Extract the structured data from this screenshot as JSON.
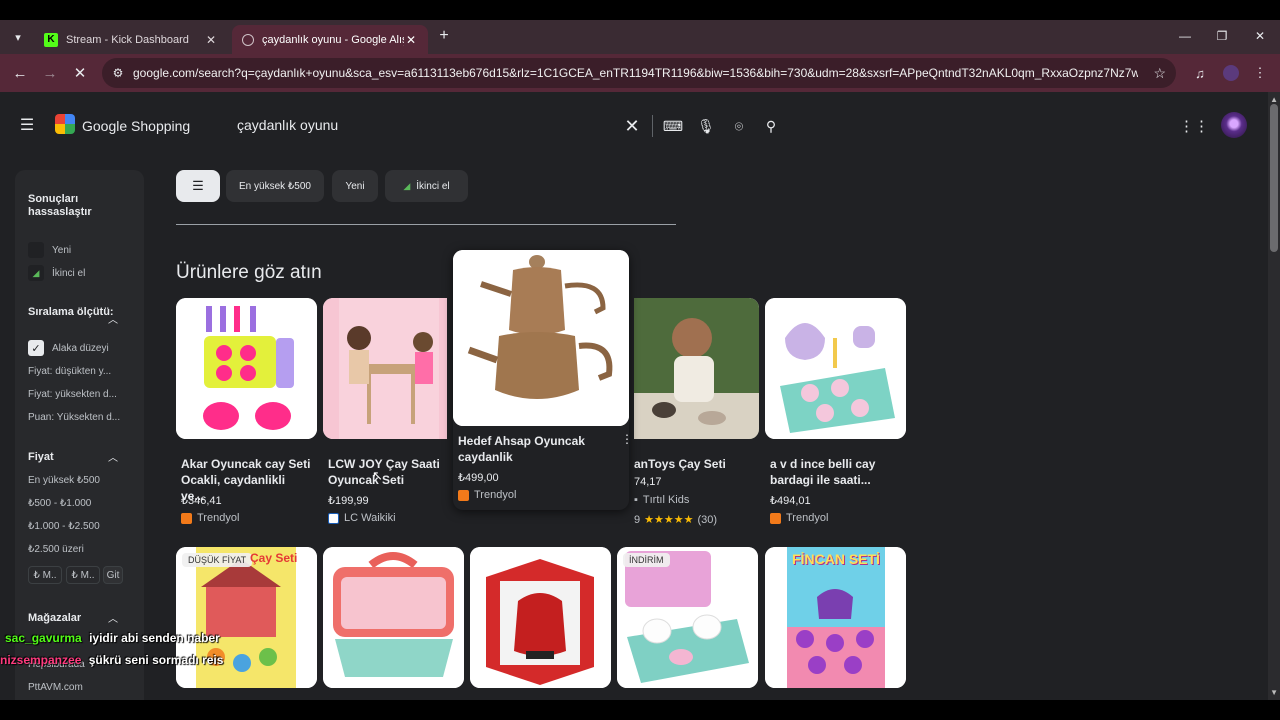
{
  "browser": {
    "tabs": [
      {
        "label": "Stream - Kick Dashboard",
        "favicon": "K"
      },
      {
        "label": "çaydanlık oyunu - Google Alışv"
      }
    ],
    "url": "google.com/search?q=çaydanlık+oyunu&sca_esv=a6113113eb676d15&rlz=1C1GCEA_enTR1194TR1196&biw=1536&bih=730&udm=28&sxsrf=APpeQntndT32nAKL0qm_RxxaOzpnz7Nz7w%3A1..."
  },
  "header": {
    "brand": "Google Shopping",
    "query": "çaydanlık oyunu"
  },
  "chips": [
    "En yüksek ₺500",
    "Yeni",
    "İkinci el"
  ],
  "sidebar": {
    "refine_title": "Sonuçları hassaslaştır",
    "condition": [
      "Yeni",
      "İkinci el"
    ],
    "sort_title": "Sıralama ölçütü:",
    "sort_items": [
      "Alaka düzeyi",
      "Fiyat: düşükten y...",
      "Fiyat: yüksekten d...",
      "Puan: Yüksekten d..."
    ],
    "price_title": "Fiyat",
    "price_items": [
      "En yüksek ₺500",
      "₺500 - ₺1.000",
      "₺1.000 - ₺2.500",
      "₺2.500 üzeri"
    ],
    "price_min": "₺ M..",
    "price_max": "₺ M..",
    "price_go": "Git",
    "stores_title": "Mağazalar",
    "store_items": [
      "Hepsiburada",
      "PttAVM.com"
    ]
  },
  "section_title": "Ürünlere göz atın",
  "products": [
    {
      "title": "Akar Oyuncak cay Seti Ocakli, caydanlikli ve...",
      "price": "₺346,41",
      "store": "Trendyol"
    },
    {
      "title": "LCW JOY Çay Saati Oyuncak Seti",
      "price": "₺199,99",
      "store": "LC Waikiki"
    },
    {
      "title": "Hedef Ahsap Oyuncak caydanlik",
      "price": "₺499,00",
      "store": "Trendyol"
    },
    {
      "title": "anToys Çay Seti",
      "price": "74,17",
      "store": "Tırtıl Kids",
      "rating_count": "(30)"
    },
    {
      "title": "a v d ince belli cay bardagi ile saati...",
      "price": "₺494,01",
      "store": "Trendyol"
    }
  ],
  "row2_badges": [
    "DÜŞÜK FİYAT",
    "İNDİRİM"
  ],
  "row2_texts": [
    "Çay Seti",
    "FİNCAN SETİ"
  ],
  "chat": [
    {
      "user": "sac_gavurma",
      "message": "iyidir abi senden naber",
      "color": "#53fc18"
    },
    {
      "user": "nizsempanzee",
      "message": "şükrü seni sormadı reis",
      "color": "#ff3b7f"
    }
  ]
}
